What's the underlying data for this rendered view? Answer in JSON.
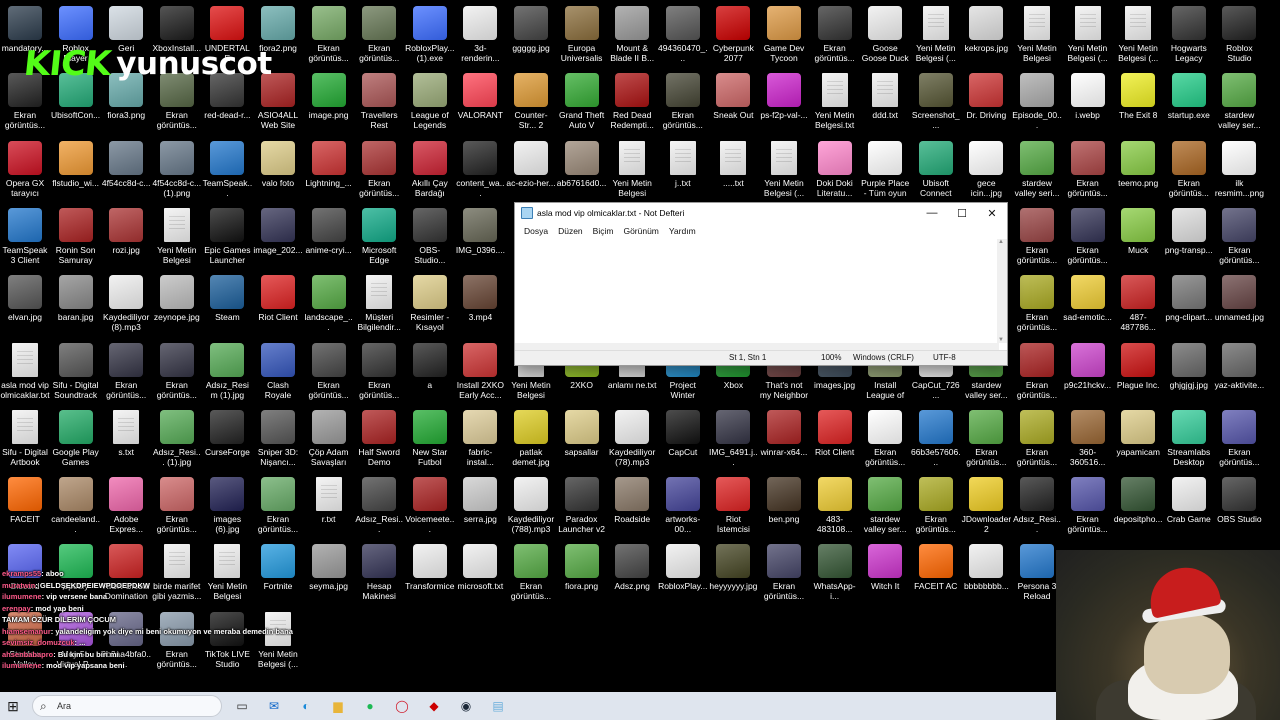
{
  "overlay": {
    "kick_brand": "KICK",
    "username": "yunuscot"
  },
  "notepad": {
    "title": "asla mod vip olmicaklar.txt - Not Defteri",
    "menus": [
      "Dosya",
      "Düzen",
      "Biçim",
      "Görünüm",
      "Yardım"
    ],
    "content": "",
    "status": {
      "position": "St 1, Stn 1",
      "zoom": "100%",
      "line_ending": "Windows (CRLF)",
      "encoding": "UTF-8"
    },
    "controls": [
      "minimize",
      "maximize",
      "close"
    ]
  },
  "desktop_icons": [
    {
      "label": "mandatory...",
      "color": "#2b3b4b"
    },
    {
      "label": "Roblox Player",
      "color": "#3b6cff"
    },
    {
      "label": "Geri",
      "color": "#cfd8e0"
    },
    {
      "label": "XboxInstall...",
      "color": "#1c1c1c"
    },
    {
      "label": "UNDERTALE",
      "color": "#d11"
    },
    {
      "label": "fiora2.png",
      "color": "#6aa"
    },
    {
      "label": "Ekran görüntüs...",
      "color": "#7a6"
    },
    {
      "label": "Ekran görüntüs...",
      "color": "#675"
    },
    {
      "label": "RobloxPlay... (1).exe",
      "color": "#3b6cff"
    },
    {
      "label": "3d-renderin...",
      "color": "#eee"
    },
    {
      "label": "ggggg.jpg",
      "color": "#444"
    },
    {
      "label": "Europa Universalis IV",
      "color": "#8a6d3b"
    },
    {
      "label": "Mount & Blade II B...",
      "color": "#999"
    },
    {
      "label": "494360470_...",
      "color": "#555"
    },
    {
      "label": "Cyberpunk 2077",
      "color": "#c00"
    },
    {
      "label": "Game Dev Tycoon",
      "color": "#d94"
    },
    {
      "label": "Ekran görüntüs...",
      "color": "#333"
    },
    {
      "label": "Goose Goose Duck",
      "color": "#eee"
    },
    {
      "label": "Yeni Metin Belgesi (...",
      "doc": true
    },
    {
      "label": "kekrops.jpg",
      "color": "#ddd"
    },
    {
      "label": "Yeni Metin Belgesi (9).txt",
      "doc": true
    },
    {
      "label": "Yeni Metin Belgesi (...",
      "doc": true
    },
    {
      "label": "Yeni Metin Belgesi (...",
      "doc": true
    },
    {
      "label": "Hogwarts Legacy",
      "color": "#333"
    },
    {
      "label": "Roblox Studio",
      "color": "#222"
    },
    {
      "label": "Ekran görüntüs...",
      "color": "#222"
    },
    {
      "label": "UbisoftCon...",
      "color": "#2a7"
    },
    {
      "label": "fiora3.png",
      "color": "#6aa"
    },
    {
      "label": "Ekran görüntüs...",
      "color": "#564"
    },
    {
      "label": "red-dead-r...",
      "color": "#333"
    },
    {
      "label": "ASIO4ALL Web Site",
      "color": "#a22"
    },
    {
      "label": "image.png",
      "color": "#2a3"
    },
    {
      "label": "Travellers Rest",
      "color": "#a55"
    },
    {
      "label": "League of Legends",
      "color": "#9a7"
    },
    {
      "label": "VALORANT",
      "color": "#f45"
    },
    {
      "label": "Counter-Str... 2",
      "color": "#d93"
    },
    {
      "label": "Grand Theft Auto V",
      "color": "#3a3"
    },
    {
      "label": "Red Dead Redempti...",
      "color": "#a11"
    },
    {
      "label": "Ekran görüntüs...",
      "color": "#443"
    },
    {
      "label": "Sneak Out",
      "color": "#c66"
    },
    {
      "label": "ps-f2p-val-...",
      "color": "#c2c"
    },
    {
      "label": "Yeni Metin Belgesi.txt",
      "doc": true
    },
    {
      "label": "ddd.txt",
      "doc": true
    },
    {
      "label": "Screenshot_...",
      "color": "#553"
    },
    {
      "label": "Dr. Driving",
      "color": "#c33"
    },
    {
      "label": "Episode_00...",
      "color": "#aaa"
    },
    {
      "label": "i.webp",
      "color": "#fff"
    },
    {
      "label": "The Exit 8",
      "color": "#ee2"
    },
    {
      "label": "startup.exe",
      "color": "#2c8"
    },
    {
      "label": "stardew valley ser...",
      "color": "#5a4"
    },
    {
      "label": "Opera GX tarayıcı",
      "color": "#c12"
    },
    {
      "label": "flstudio_wi...",
      "color": "#e93"
    },
    {
      "label": "4f54cc8d-c...",
      "color": "#678"
    },
    {
      "label": "4f54cc8d-c... (1).png",
      "color": "#678"
    },
    {
      "label": "TeamSpeak...",
      "color": "#27c"
    },
    {
      "label": "valo foto",
      "color": "#dc8"
    },
    {
      "label": "Lightning_...",
      "color": "#c33"
    },
    {
      "label": "Ekran görüntüs...",
      "color": "#a33"
    },
    {
      "label": "Akıllı Çay Bardağı",
      "color": "#c23"
    },
    {
      "label": "content_wa...",
      "color": "#222"
    },
    {
      "label": "ac-ezio-her...",
      "color": "#eee"
    },
    {
      "label": "ab67616d0...",
      "color": "#987"
    },
    {
      "label": "Yeni Metin Belgesi (4).txt",
      "doc": true
    },
    {
      "label": "j..txt",
      "doc": true
    },
    {
      "label": ".....txt",
      "doc": true
    },
    {
      "label": "Yeni Metin Belgesi (...",
      "doc": true
    },
    {
      "label": "Doki Doki Literatu...",
      "color": "#f8c"
    },
    {
      "label": "Purple Place - Tüm oyun",
      "color": "#fff"
    },
    {
      "label": "Ubisoft Connect",
      "color": "#2a7"
    },
    {
      "label": "gece icin...jpg",
      "color": "#fff"
    },
    {
      "label": "stardew valley seri...",
      "color": "#5a4"
    },
    {
      "label": "Ekran görüntüs...",
      "color": "#a44"
    },
    {
      "label": "teemo.png",
      "color": "#8c4"
    },
    {
      "label": "Ekran görüntüs...",
      "color": "#a62"
    },
    {
      "label": "ilk resmim...png",
      "color": "#fff"
    },
    {
      "label": "TeamSpeak 3 Client",
      "color": "#27c"
    },
    {
      "label": "Ronin Son Samuray",
      "color": "#a22"
    },
    {
      "label": "rozi.jpg",
      "color": "#a33"
    },
    {
      "label": "Yeni Metin Belgesi (7).txt",
      "doc": true
    },
    {
      "label": "Epic Games Launcher",
      "color": "#111"
    },
    {
      "label": "image_202...",
      "color": "#335"
    },
    {
      "label": "anime-cryi...",
      "color": "#444"
    },
    {
      "label": "Microsoft Edge",
      "color": "#1a8"
    },
    {
      "label": "OBS-Studio...",
      "color": "#333"
    },
    {
      "label": "IMG_0396....",
      "color": "#665"
    },
    {
      "label": "Ekran görüntüs...",
      "color": "#944"
    },
    {
      "label": "Ekran görüntüs...",
      "color": "#335"
    },
    {
      "label": "Muck",
      "color": "#8c4"
    },
    {
      "label": "png-transp...",
      "color": "#ddd"
    },
    {
      "label": "Ekran görüntüs...",
      "color": "#446"
    },
    {
      "label": "elvan.jpg",
      "color": "#555"
    },
    {
      "label": "baran.jpg",
      "color": "#888"
    },
    {
      "label": "Kaydediliyor (8).mp3",
      "color": "#eee"
    },
    {
      "label": "zeynope.jpg",
      "color": "#bbb"
    },
    {
      "label": "Steam",
      "color": "#1b5e9a"
    },
    {
      "label": "Riot Client",
      "color": "#d22"
    },
    {
      "label": "landscape_...",
      "color": "#5a4"
    },
    {
      "label": "Müşteri Bilgilendir...",
      "doc": true
    },
    {
      "label": "Resimler - Kısayol",
      "color": "#dc8"
    },
    {
      "label": "3.mp4",
      "color": "#643"
    },
    {
      "label": "Ekran görüntüs...",
      "color": "#aa2"
    },
    {
      "label": "sad-emotic...",
      "color": "#ec3"
    },
    {
      "label": "487-487786...",
      "color": "#c22"
    },
    {
      "label": "png-clipart...",
      "color": "#777"
    },
    {
      "label": "unnamed.jpg",
      "color": "#644"
    },
    {
      "label": "asla mod vip olmicaklar.txt",
      "doc": true
    },
    {
      "label": "Sifu - Digital Soundtrack",
      "color": "#555"
    },
    {
      "label": "Ekran görüntüs...",
      "color": "#334"
    },
    {
      "label": "Ekran görüntüs...",
      "color": "#334"
    },
    {
      "label": "Adsız_Resim (1).jpg",
      "color": "#5a5"
    },
    {
      "label": "Clash Royale",
      "color": "#35b"
    },
    {
      "label": "Ekran görüntüs...",
      "color": "#444"
    },
    {
      "label": "Ekran görüntüs...",
      "color": "#333"
    },
    {
      "label": "a",
      "color": "#222"
    },
    {
      "label": "Install 2XKO Early Acc...",
      "color": "#c33"
    },
    {
      "label": "Yeni Metin Belgesi (6).txt",
      "doc": true
    },
    {
      "label": "2XKO",
      "color": "#9c2"
    },
    {
      "label": "anlamı ne.txt",
      "doc": true
    },
    {
      "label": "Project Winter",
      "color": "#29d"
    },
    {
      "label": "Xbox",
      "color": "#2a3"
    },
    {
      "label": "That's not my Neighbor",
      "color": "#744"
    },
    {
      "label": "images.jpg",
      "color": "#456"
    },
    {
      "label": "Install League of Legends ...",
      "color": "#9a7"
    },
    {
      "label": "CapCut_726...",
      "color": "#fff"
    },
    {
      "label": "stardew valley ser...",
      "color": "#5a4"
    },
    {
      "label": "Ekran görüntüs...",
      "color": "#a22"
    },
    {
      "label": "p9c21hckv...",
      "color": "#c4c"
    },
    {
      "label": "Plague Inc.",
      "color": "#c11"
    },
    {
      "label": "ghjgjgj.jpg",
      "color": "#666"
    },
    {
      "label": "yaz-aktivite...",
      "color": "#666"
    },
    {
      "label": "Sifu - Digital Artbook",
      "doc": true
    },
    {
      "label": "Google Play Games",
      "color": "#2a6"
    },
    {
      "label": "s.txt",
      "doc": true
    },
    {
      "label": "Adsız_Resi... (1).jpg",
      "color": "#5a5"
    },
    {
      "label": "CurseForge",
      "color": "#222"
    },
    {
      "label": "Sniper 3D: Nişancı...",
      "color": "#555"
    },
    {
      "label": "Çöp Adam Savaşları",
      "color": "#999"
    },
    {
      "label": "Half Sword Demo",
      "color": "#a22"
    },
    {
      "label": "New Star Futbol",
      "color": "#2a3"
    },
    {
      "label": "fabric-instal...",
      "color": "#dc9"
    },
    {
      "label": "patlak demet.jpg",
      "color": "#dc2"
    },
    {
      "label": "sapsallar",
      "color": "#dc8"
    },
    {
      "label": "Kaydediliyor (78).mp3",
      "color": "#eee"
    },
    {
      "label": "CapCut",
      "color": "#111"
    },
    {
      "label": "IMG_6491.j...",
      "color": "#334"
    },
    {
      "label": "winrar-x64...",
      "color": "#a22"
    },
    {
      "label": "Riot Client",
      "color": "#d22"
    },
    {
      "label": "Ekran görüntüs...",
      "color": "#fff"
    },
    {
      "label": "66b3e57606...",
      "color": "#27c"
    },
    {
      "label": "Ekran görüntüs...",
      "color": "#5a4"
    },
    {
      "label": "Ekran görüntüs...",
      "color": "#aa2"
    },
    {
      "label": "360-360516...",
      "color": "#963"
    },
    {
      "label": "yapamicam",
      "color": "#dc8"
    },
    {
      "label": "Streamlabs Desktop",
      "color": "#3c9"
    },
    {
      "label": "Ekran görüntüs...",
      "color": "#55a"
    },
    {
      "label": "FACEIT",
      "color": "#f60"
    },
    {
      "label": "candeeland...",
      "color": "#a86"
    },
    {
      "label": "Adobe Expres...",
      "color": "#e6a"
    },
    {
      "label": "Ekran görüntüs...",
      "color": "#c66"
    },
    {
      "label": "images (6).jpg",
      "color": "#225"
    },
    {
      "label": "Ekran görüntüs...",
      "color": "#6a6"
    },
    {
      "label": "r.txt",
      "doc": true
    },
    {
      "label": "Adsız_Resi...",
      "color": "#444"
    },
    {
      "label": "Voicemeete...",
      "color": "#a22"
    },
    {
      "label": "serra.jpg",
      "color": "#ccc"
    },
    {
      "label": "Kaydediliyor (788).mp3",
      "color": "#eee"
    },
    {
      "label": "Paradox Launcher v2",
      "color": "#333"
    },
    {
      "label": "Roadside",
      "color": "#876"
    },
    {
      "label": "artworks-00...",
      "color": "#449"
    },
    {
      "label": "Riot İstemcisi",
      "color": "#d22"
    },
    {
      "label": "ben.png",
      "color": "#432"
    },
    {
      "label": "483-483108...",
      "color": "#ec3"
    },
    {
      "label": "stardew valley ser...",
      "color": "#5a4"
    },
    {
      "label": "Ekran görüntüs...",
      "color": "#aa2"
    },
    {
      "label": "JDownloader 2",
      "color": "#ec2"
    },
    {
      "label": "Adsız_Resi...",
      "color": "#222"
    },
    {
      "label": "Ekran görüntüs...",
      "color": "#55a"
    },
    {
      "label": "depositpho...",
      "color": "#353"
    },
    {
      "label": "Crab Game",
      "color": "#eee"
    },
    {
      "label": "OBS Studio",
      "color": "#333"
    },
    {
      "label": "Discord",
      "color": "#5865f2"
    },
    {
      "label": "Spotify",
      "color": "#1db954"
    },
    {
      "label": "RISK Global Domination",
      "color": "#c22"
    },
    {
      "label": "birde marifet gibi yazmis...",
      "doc": true
    },
    {
      "label": "Yeni Metin Belgesi (5).txt",
      "doc": true
    },
    {
      "label": "Fortnite",
      "color": "#29d"
    },
    {
      "label": "seyma.jpg",
      "color": "#999"
    },
    {
      "label": "Hesap Makinesi",
      "color": "#335"
    },
    {
      "label": "Transformice",
      "color": "#eee"
    },
    {
      "label": "microsoft.txt",
      "color": "#eee"
    },
    {
      "label": "Ekran görüntüs...",
      "color": "#5a4"
    },
    {
      "label": "fiora.png",
      "color": "#5a4"
    },
    {
      "label": "Adsz.png",
      "color": "#444"
    },
    {
      "label": "RobloxPlay...",
      "color": "#eee"
    },
    {
      "label": "heyyyyyy.jpg",
      "color": "#442"
    },
    {
      "label": "Ekran görüntüs...",
      "color": "#446"
    },
    {
      "label": "WhatsApp-i...",
      "color": "#353"
    },
    {
      "label": "Witch It",
      "color": "#c3c"
    },
    {
      "label": "FACEIT AC",
      "color": "#f60"
    },
    {
      "label": "bbbbbbbb...",
      "color": "#eee"
    },
    {
      "label": "Persona 3 Reload",
      "color": "#27c"
    },
    {
      "label": "Stardew Valley",
      "color": "#c64"
    },
    {
      "label": "Moy 5 - Virtual P...",
      "color": "#a5d"
    },
    {
      "label": "9b2aa4bfa0...",
      "color": "#668"
    },
    {
      "label": "Ekran görüntüs...",
      "color": "#89a"
    },
    {
      "label": "TikTok LIVE Studio",
      "color": "#111"
    },
    {
      "label": "Yeni Metin Belgesi (...",
      "doc": true
    }
  ],
  "chat": [
    {
      "user": "ekramps55",
      "msg": ": aboo"
    },
    {
      "user": "muratwin",
      "msg": ": GELDŞEKDPEIEWPDOEPDKW"
    },
    {
      "user": "ilumumene",
      "msg": ": vip versene bana"
    },
    {
      "user": "erenpay",
      "msg": ": mod yap beni"
    },
    {
      "user": "",
      "msg": "TAMAM ÖZÜR DİLERİM ÇOCUM"
    },
    {
      "user": "hiamsemanur",
      "msg": ": yalandeligim yok diye mi beni okumuyon ve meraba demedin bana"
    },
    {
      "user": "sevimsiz_domuzcuk",
      "msg": ": ..."
    },
    {
      "user": "ahsenbabapro",
      "msg": ": Bu kim bu biri mi"
    },
    {
      "user": "ilumumene",
      "msg": ": mod vip yapsana beni"
    }
  ],
  "taskbar": {
    "search_placeholder": "Ara",
    "apps": [
      {
        "name": "task-view",
        "glyph": "▭",
        "color": "#333"
      },
      {
        "name": "outlook",
        "glyph": "✉",
        "color": "#0a64c8"
      },
      {
        "name": "edge",
        "glyph": "◐",
        "color": "#1a8ad8"
      },
      {
        "name": "file-explorer",
        "glyph": "▆",
        "color": "#e8b53a"
      },
      {
        "name": "spotify",
        "glyph": "●",
        "color": "#1db954"
      },
      {
        "name": "opera",
        "glyph": "◯",
        "color": "#d01a2a"
      },
      {
        "name": "cyberpunk",
        "glyph": "◆",
        "color": "#c00"
      },
      {
        "name": "steam",
        "glyph": "◉",
        "color": "#1b2838"
      },
      {
        "name": "notepad",
        "glyph": "▤",
        "color": "#6aaedb"
      }
    ]
  }
}
